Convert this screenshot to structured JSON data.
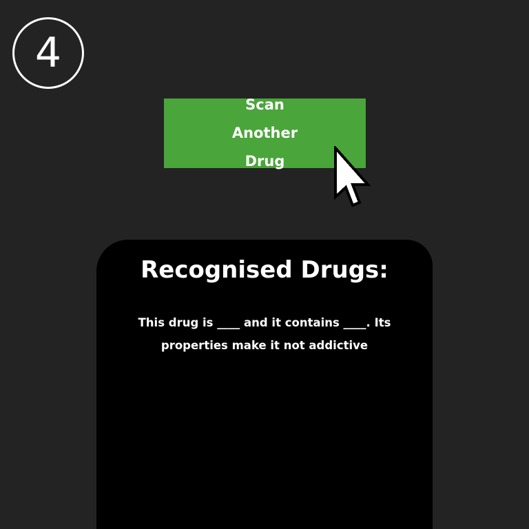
{
  "step_badge": {
    "number": "4"
  },
  "scan_button": {
    "label": "Scan Another Drug",
    "color": "#4aa53a"
  },
  "cursor": {
    "icon": "arrow-pointer-icon"
  },
  "results_panel": {
    "title": "Recognised Drugs:",
    "description": "This drug is ____ and it contains ____. Its properties make it not addictive"
  },
  "colors": {
    "background": "#232323",
    "panel": "#000000",
    "text": "#ffffff"
  }
}
